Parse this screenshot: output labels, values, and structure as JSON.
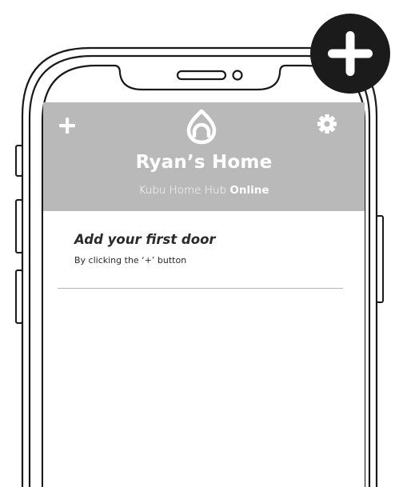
{
  "header": {
    "home_name": "Ryan’s Home",
    "hub_name": "Kubu Home Hub",
    "hub_status": "Online"
  },
  "icons": {
    "add": "plus-icon",
    "settings": "gear-icon",
    "logo": "kubu-logo-icon",
    "badge": "plus-icon"
  },
  "empty_state": {
    "title": "Add your first door",
    "subtitle": "By clicking the ‘+’ button"
  },
  "colors": {
    "header_bg": "#b9b9b9",
    "header_text": "#ffffff",
    "body_text": "#2a2a2a",
    "badge_bg": "#1b1b1b",
    "frame_stroke": "#1a1a1a"
  }
}
